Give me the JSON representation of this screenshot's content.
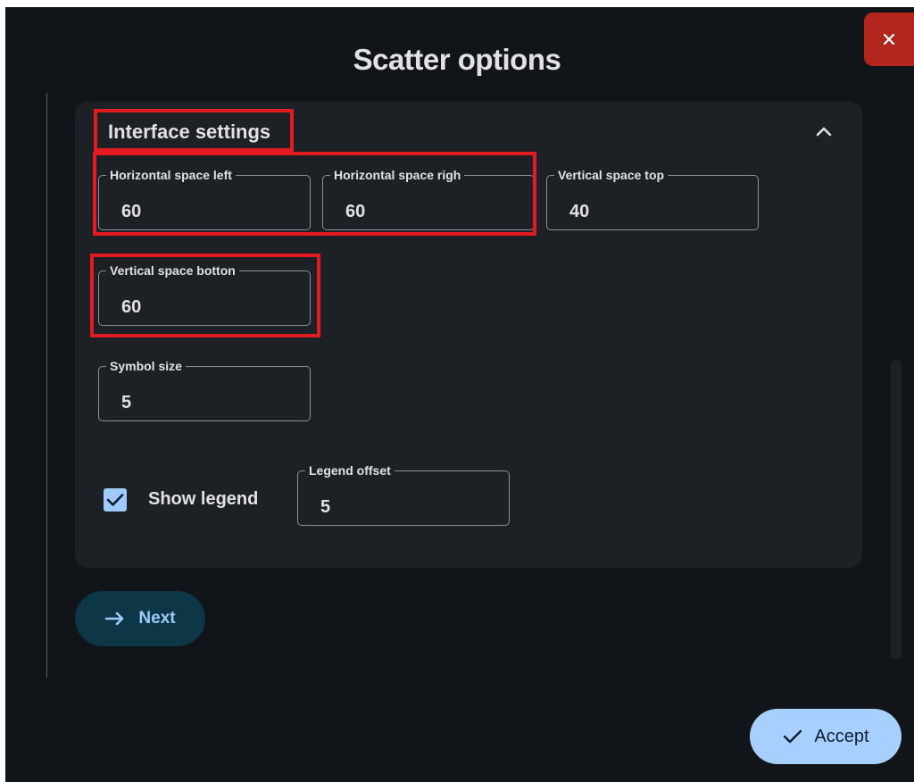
{
  "dialog": {
    "title": "Scatter options",
    "close_icon": "close-icon"
  },
  "section": {
    "title": "Interface settings",
    "toggle_icon": "chevron-up-icon",
    "fields": {
      "horizontal_space_left": {
        "label": "Horizontal space left",
        "value": "60"
      },
      "horizontal_space_right": {
        "label": "Horizontal space righ",
        "value": "60"
      },
      "vertical_space_top": {
        "label": "Vertical space top",
        "value": "40"
      },
      "vertical_space_bottom": {
        "label": "Vertical space botton",
        "value": "60"
      },
      "symbol_size": {
        "label": "Symbol size",
        "value": "5"
      },
      "legend_offset": {
        "label": "Legend offset",
        "value": "5"
      }
    },
    "show_legend": {
      "label": "Show legend",
      "checked": true,
      "icon": "checkmark-icon"
    }
  },
  "buttons": {
    "next": {
      "label": "Next",
      "icon": "arrow-right-icon"
    },
    "accept": {
      "label": "Accept",
      "icon": "checkmark-icon"
    }
  },
  "colors": {
    "dialog_background": "#111418",
    "panel_background": "#1d2024",
    "close_button": "#b3261e",
    "accent": "#9ecaff",
    "highlight_annotation": "#e21b23"
  }
}
